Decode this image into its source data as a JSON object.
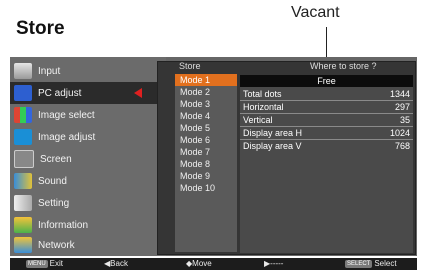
{
  "page": {
    "title": "Store",
    "callout": "Vacant"
  },
  "sidebar": {
    "items": [
      {
        "label": "Input"
      },
      {
        "label": "PC adjust"
      },
      {
        "label": "Image select"
      },
      {
        "label": "Image adjust"
      },
      {
        "label": "Screen"
      },
      {
        "label": "Sound"
      },
      {
        "label": "Setting"
      },
      {
        "label": "Information"
      },
      {
        "label": "Network"
      }
    ]
  },
  "panel": {
    "title": "Store",
    "prompt": "Where to store ?",
    "modes": [
      "Mode 1",
      "Mode 2",
      "Mode 3",
      "Mode 4",
      "Mode 5",
      "Mode 6",
      "Mode 7",
      "Mode 8",
      "Mode 9",
      "Mode 10"
    ],
    "free_label": "Free",
    "rows": [
      {
        "key": "Total dots",
        "value": "1344"
      },
      {
        "key": "Horizontal",
        "value": "297"
      },
      {
        "key": "Vertical",
        "value": "35"
      },
      {
        "key": "Display area H",
        "value": "1024"
      },
      {
        "key": "Display area V",
        "value": "768"
      }
    ]
  },
  "footer": {
    "exit_key": "MENU",
    "exit": "Exit",
    "back": "◀Back",
    "move": "◆Move",
    "next": "▶-----",
    "select_key": "SELECT",
    "select": "Select"
  },
  "colors": {
    "active_mode": "#e2701e",
    "marker": "#e02020"
  }
}
